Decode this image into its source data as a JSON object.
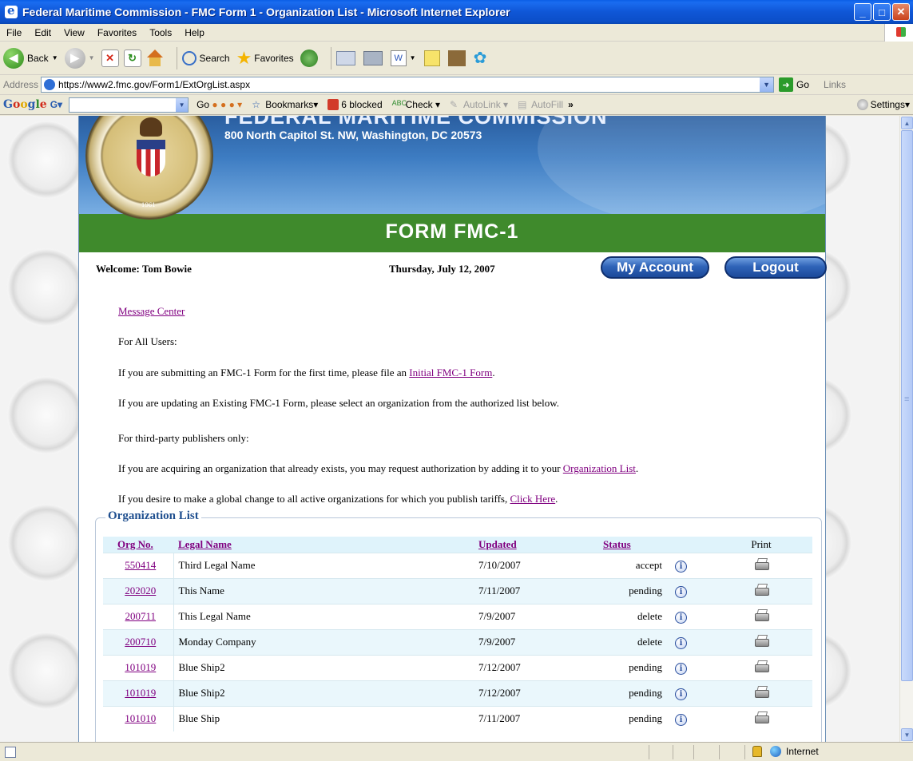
{
  "window": {
    "title": "Federal Maritime Commission - FMC Form 1 - Organization List - Microsoft Internet Explorer"
  },
  "menu": [
    "File",
    "Edit",
    "View",
    "Favorites",
    "Tools",
    "Help"
  ],
  "toolbar": {
    "back_label": "Back",
    "search_label": "Search",
    "favorites_label": "Favorites"
  },
  "address": {
    "label": "Address",
    "url": "https://www2.fmc.gov/Form1/ExtOrgList.aspx",
    "go_label": "Go",
    "links_label": "Links"
  },
  "google_toolbar": {
    "go_label": "Go",
    "bookmarks_label": "Bookmarks",
    "blocked_label": "6 blocked",
    "check_label": "Check",
    "autolink_label": "AutoLink",
    "autofill_label": "AutoFill",
    "settings_label": "Settings"
  },
  "header": {
    "agency": "FEDERAL MARITIME COMMISSION",
    "address": "800 North Capitol St. NW, Washington, DC 20573",
    "seal_year": "1961",
    "form_title": "FORM FMC-1"
  },
  "user_bar": {
    "welcome": "Welcome: Tom Bowie",
    "date": "Thursday, July 12, 2007",
    "account_button": "My Account",
    "logout_button": "Logout"
  },
  "content": {
    "message_center": "Message Center",
    "all_users": "For All Users:",
    "first_time_prefix": "If you are submitting an FMC-1 Form for the first time, please file an ",
    "first_time_link": "Initial FMC-1 Form",
    "first_time_suffix": ".",
    "updating": "If you are updating an Existing FMC-1 Form, please select an organization from the authorized list below.",
    "third_party": "For third-party publishers only:",
    "acquiring_prefix": "If you are acquiring an organization that already exists, you may request authorization by adding it to your ",
    "acquiring_link": "Organization List",
    "acquiring_suffix": ".",
    "global_prefix": "If you desire to make a global change to all active organizations for which you publish tariffs, ",
    "global_link": "Click Here",
    "global_suffix": "."
  },
  "org_list": {
    "legend": "Organization List",
    "columns": {
      "org_no": "Org No.",
      "legal_name": "Legal Name",
      "updated": "Updated",
      "status": "Status",
      "print": "Print"
    },
    "rows": [
      {
        "org_no": "550414",
        "legal_name": "Third Legal Name",
        "updated": "7/10/2007",
        "status": "accept"
      },
      {
        "org_no": "202020",
        "legal_name": "This Name",
        "updated": "7/11/2007",
        "status": "pending"
      },
      {
        "org_no": "200711",
        "legal_name": "This Legal Name",
        "updated": "7/9/2007",
        "status": "delete"
      },
      {
        "org_no": "200710",
        "legal_name": "Monday Company",
        "updated": "7/9/2007",
        "status": "delete"
      },
      {
        "org_no": "101019",
        "legal_name": "Blue Ship2",
        "updated": "7/12/2007",
        "status": "pending"
      },
      {
        "org_no": "101019",
        "legal_name": "Blue Ship2",
        "updated": "7/12/2007",
        "status": "pending"
      },
      {
        "org_no": "101010",
        "legal_name": "Blue Ship",
        "updated": "7/11/2007",
        "status": "pending"
      }
    ]
  },
  "statusbar": {
    "zone": "Internet"
  }
}
